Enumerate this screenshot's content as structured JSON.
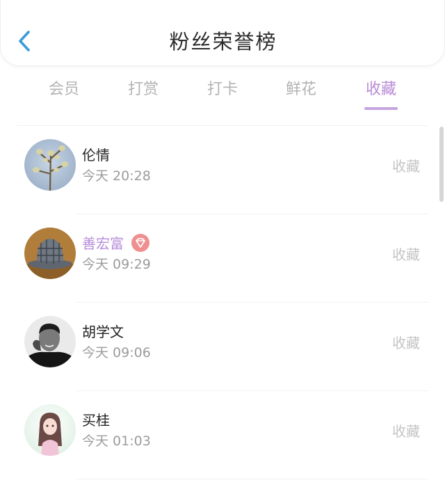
{
  "header": {
    "title": "粉丝荣誉榜",
    "back_icon": "chevron-left-icon",
    "accent": "#3a9bdc"
  },
  "tabs": [
    {
      "label": "会员",
      "active": false
    },
    {
      "label": "打赏",
      "active": false
    },
    {
      "label": "打卡",
      "active": false
    },
    {
      "label": "鲜花",
      "active": false
    },
    {
      "label": "收藏",
      "active": true
    }
  ],
  "tab_active_color": "#b98ad6",
  "list": [
    {
      "name": "伦情",
      "time": "今天 20:28",
      "action": "收藏",
      "avatar": "willow-branch-photo"
    },
    {
      "name": "善宏富",
      "time": "今天 09:29",
      "action": "收藏",
      "avatar": "plaid-hat-photo",
      "vip_badge": "diamond-badge-icon"
    },
    {
      "name": "胡学文",
      "time": "今天 09:06",
      "action": "收藏",
      "avatar": "man-portrait-photo"
    },
    {
      "name": "买桂",
      "time": "今天 01:03",
      "action": "收藏",
      "avatar": "anime-girl-photo"
    }
  ]
}
